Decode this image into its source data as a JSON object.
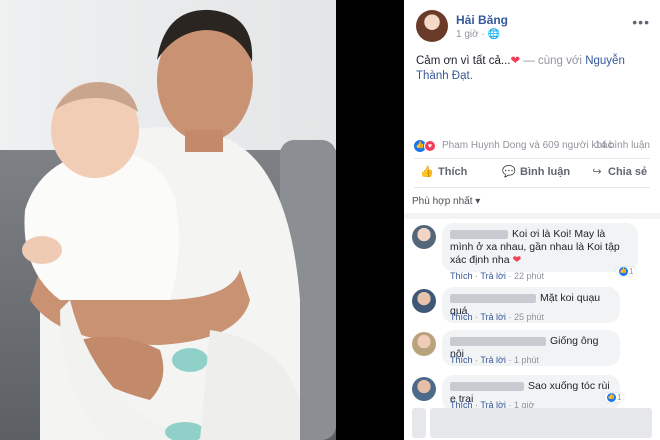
{
  "post": {
    "author": "Hải Băng",
    "time": "1 giờ",
    "globe_icon": "globe-icon",
    "more": "•••",
    "text": "Cảm ơn vì tất cả...",
    "with_text": "— cùng với",
    "tagged": "Nguyễn Thành Đạt."
  },
  "reactions": {
    "names": "Pham Huynh Dong và 609 người khác",
    "comments": "14 bình luận"
  },
  "actions": {
    "like": "Thích",
    "comment": "Bình luận",
    "share": "Chia sẻ"
  },
  "sort": {
    "label": "Phù hợp nhất"
  },
  "comments": [
    {
      "text": "Koi ơi là Koi! May là mình ở xa nhau, gần nhau là Koi tập xác định nha",
      "like": "Thích",
      "reply": "Trả lời",
      "time": "22 phút",
      "likes": "1",
      "has_heart": true
    },
    {
      "text": "Mặt koi quạu quá",
      "like": "Thích",
      "reply": "Trả lời",
      "time": "25 phút"
    },
    {
      "text": "Giống ông nội",
      "like": "Thích",
      "reply": "Trả lời",
      "time": "1 phút"
    },
    {
      "text": "Sao xuống tóc rùi e trai",
      "like": "Thích",
      "reply": "Trả lời",
      "time": "1 giờ",
      "likes": "1"
    }
  ],
  "colors": {
    "link": "#365899",
    "accent": "#1877f2",
    "heart": "#f33e58"
  }
}
